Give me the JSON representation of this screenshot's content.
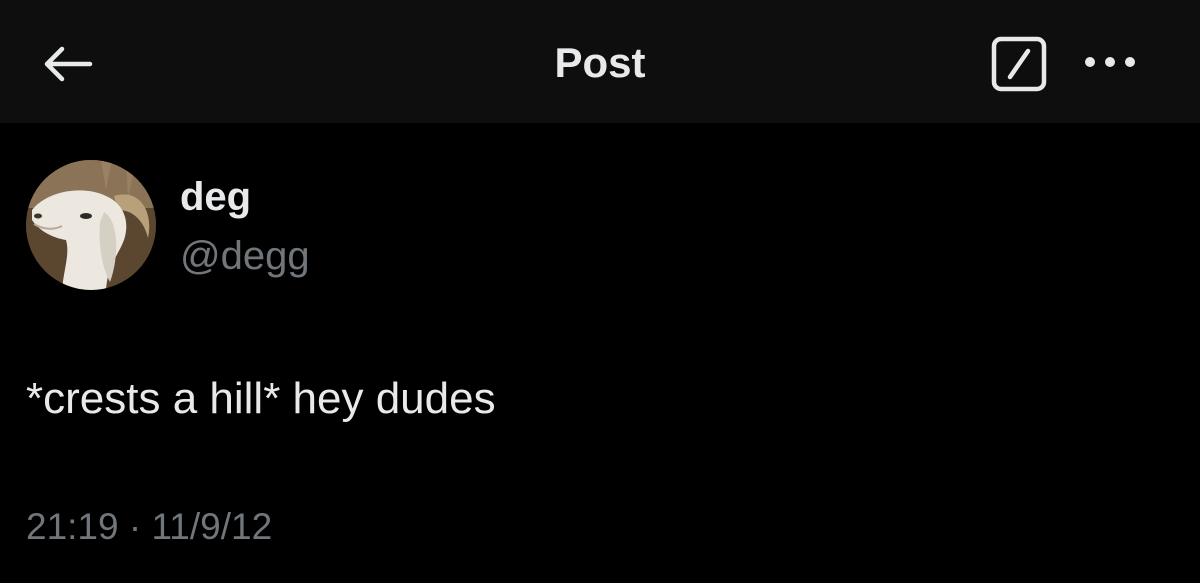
{
  "header": {
    "title": "Post",
    "back_icon": "arrow-left-icon",
    "edit_icon": "edit-box-icon",
    "more_icon": "more-horizontal-icon"
  },
  "post": {
    "author_name": "deg",
    "author_handle": "@degg",
    "text": "*crests a hill* hey dudes",
    "timestamp": "21:19 · 11/9/12"
  },
  "colors": {
    "background": "#000000",
    "header_background": "#0e0e0e",
    "primary_text": "#e7e9ea",
    "secondary_text": "#71767b"
  }
}
